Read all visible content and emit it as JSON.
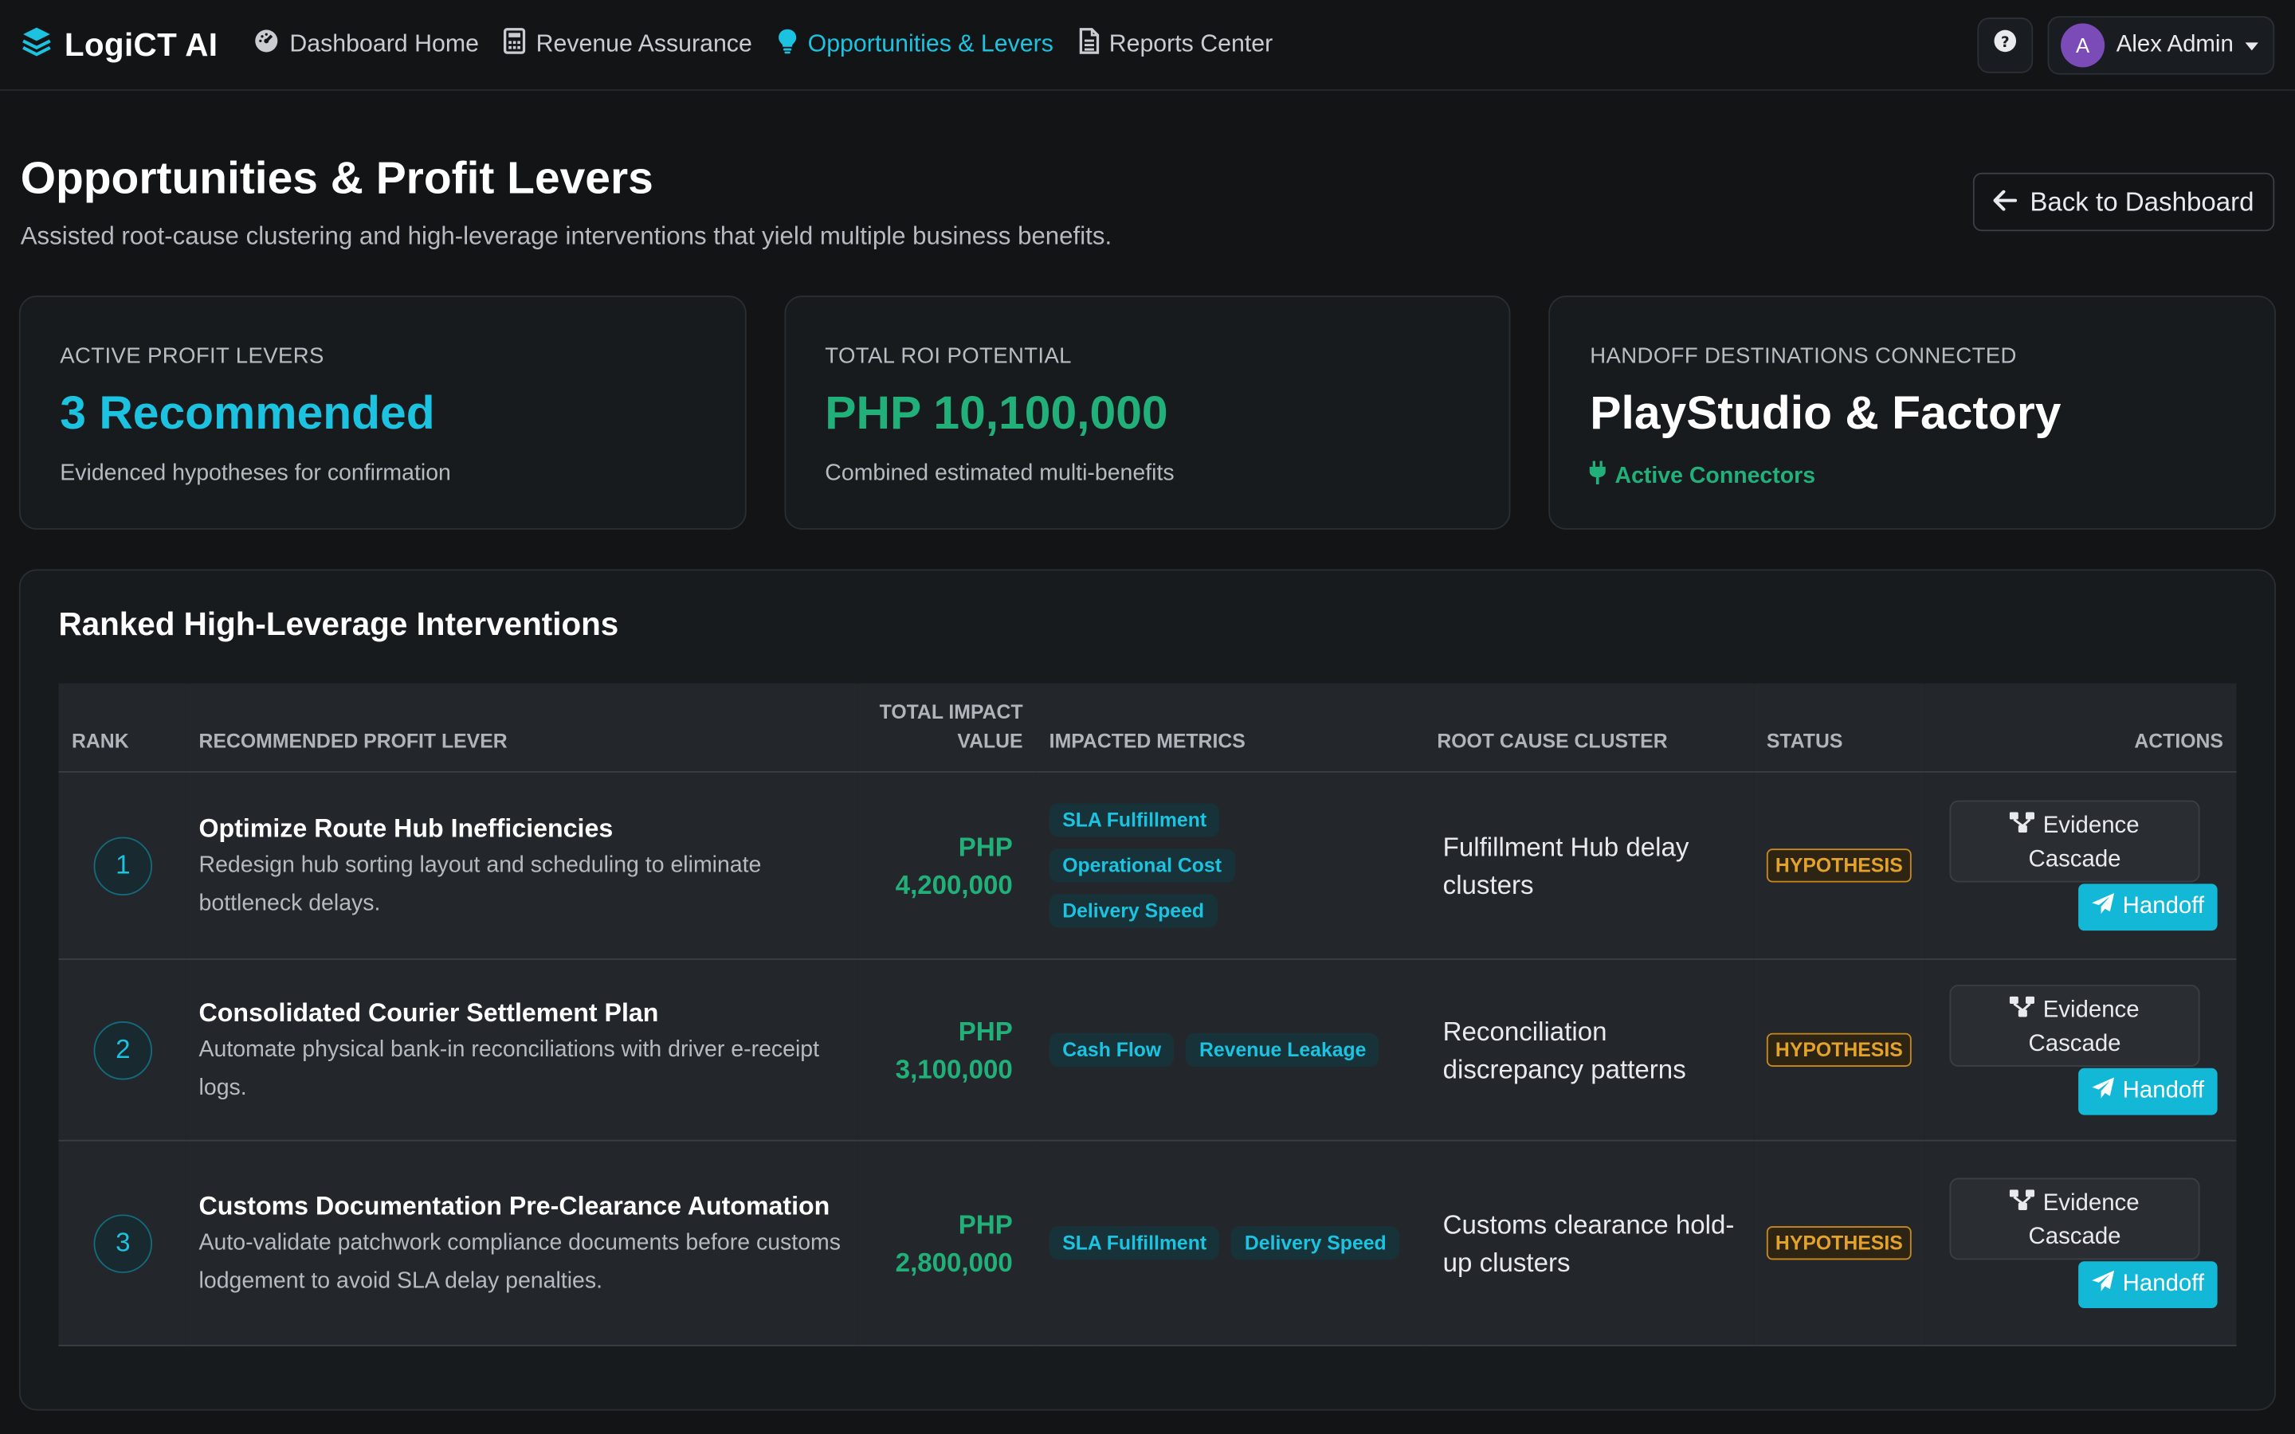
{
  "brand": {
    "name": "LogiCT AI"
  },
  "nav": {
    "items": [
      {
        "label": "Dashboard Home",
        "active": false
      },
      {
        "label": "Revenue Assurance",
        "active": false
      },
      {
        "label": "Opportunities & Levers",
        "active": true
      },
      {
        "label": "Reports Center",
        "active": false
      }
    ]
  },
  "user": {
    "initial": "A",
    "name": "Alex Admin"
  },
  "header": {
    "title": "Opportunities & Profit Levers",
    "subtitle": "Assisted root-cause clustering and high-leverage interventions that yield multiple business benefits.",
    "back_label": "Back to Dashboard"
  },
  "cards": [
    {
      "label": "Active Profit Levers",
      "value": "3 Recommended",
      "note": "Evidenced hypotheses for confirmation"
    },
    {
      "label": "Total ROI Potential",
      "value": "PHP 10,100,000",
      "note": "Combined estimated multi-benefits"
    },
    {
      "label": "Handoff Destinations Connected",
      "value": "PlayStudio & Factory",
      "note": "Active Connectors"
    }
  ],
  "table": {
    "title": "Ranked High-Leverage Interventions",
    "headers": {
      "rank": "Rank",
      "lever": "Recommended Profit Lever",
      "impact_line1": "Total Impact",
      "impact_line2": "Value",
      "metrics": "Impacted Metrics",
      "root": "Root Cause Cluster",
      "status": "Status",
      "actions": "Actions"
    },
    "rows": [
      {
        "rank": "1",
        "title": "Optimize Route Hub Inefficiencies",
        "desc": "Redesign hub sorting layout and scheduling to eliminate bottleneck delays.",
        "currency": "PHP",
        "amount": "4,200,000",
        "metrics": [
          "SLA Fulfillment",
          "Operational Cost",
          "Delivery Speed"
        ],
        "root": "Fulfillment Hub delay clusters",
        "status": "HYPOTHESIS",
        "evidence_line1": "Evidence",
        "evidence_line2": "Cascade",
        "handoff": "Handoff"
      },
      {
        "rank": "2",
        "title": "Consolidated Courier Settlement Plan",
        "desc": "Automate physical bank-in reconciliations with driver e-receipt logs.",
        "currency": "PHP",
        "amount": "3,100,000",
        "metrics": [
          "Cash Flow",
          "Revenue Leakage"
        ],
        "root": "Reconciliation discrepancy patterns",
        "status": "HYPOTHESIS",
        "evidence_line1": "Evidence",
        "evidence_line2": "Cascade",
        "handoff": "Handoff"
      },
      {
        "rank": "3",
        "title": "Customs Documentation Pre-Clearance Automation",
        "desc": "Auto-validate patchwork compliance documents before customs lodgement to avoid SLA delay penalties.",
        "currency": "PHP",
        "amount": "2,800,000",
        "metrics": [
          "SLA Fulfillment",
          "Delivery Speed"
        ],
        "root": "Customs clearance hold-up clusters",
        "status": "HYPOTHESIS",
        "evidence_line1": "Evidence",
        "evidence_line2": "Cascade",
        "handoff": "Handoff"
      }
    ]
  }
}
